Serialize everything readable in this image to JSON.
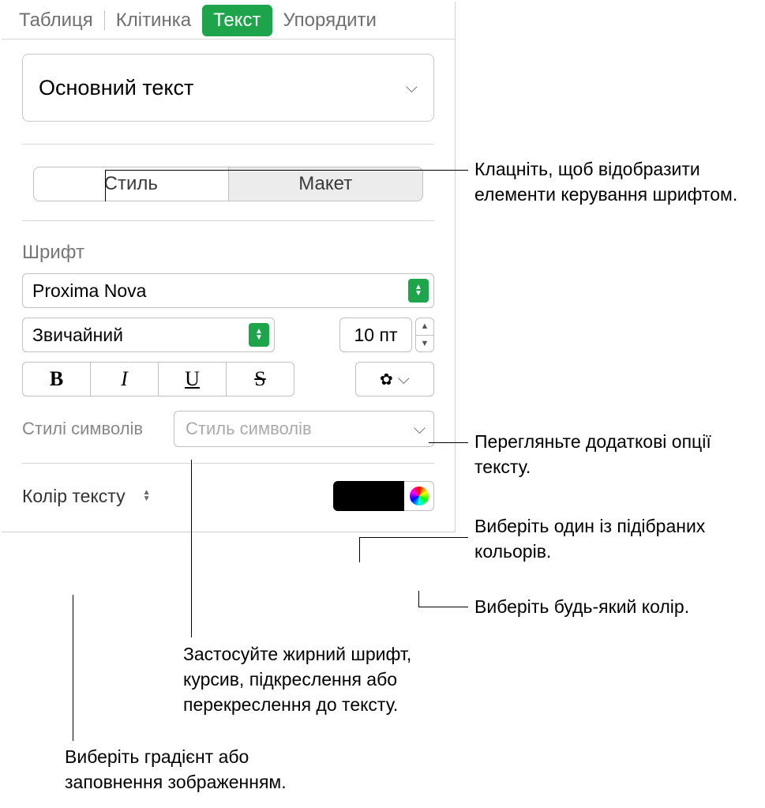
{
  "tabs": {
    "table": "Таблиця",
    "cell": "Клітинка",
    "text": "Текст",
    "arrange": "Упорядити"
  },
  "paragraph_style": "Основний текст",
  "segments": {
    "style": "Стиль",
    "layout": "Макет"
  },
  "font_section_label": "Шрифт",
  "font_name": "Proxima Nova",
  "font_weight": "Звичайний",
  "font_size": "10 пт",
  "bius": {
    "b": "B",
    "i": "I",
    "u": "U",
    "s": "S"
  },
  "char_styles_label": "Стилі символів",
  "char_styles_placeholder": "Стиль символів",
  "text_color_label": "Колір тексту",
  "callouts": {
    "c1": "Клацніть, щоб відобразити елементи керування шрифтом.",
    "c2": "Перегляньте додаткові опції тексту.",
    "c3": "Виберіть один із підібраних кольорів.",
    "c4": "Виберіть будь-який колір.",
    "c5": "Застосуйте жирний шрифт, курсив, підкреслення або перекреслення до тексту.",
    "c6": "Виберіть градієнт або заповнення зображенням."
  }
}
